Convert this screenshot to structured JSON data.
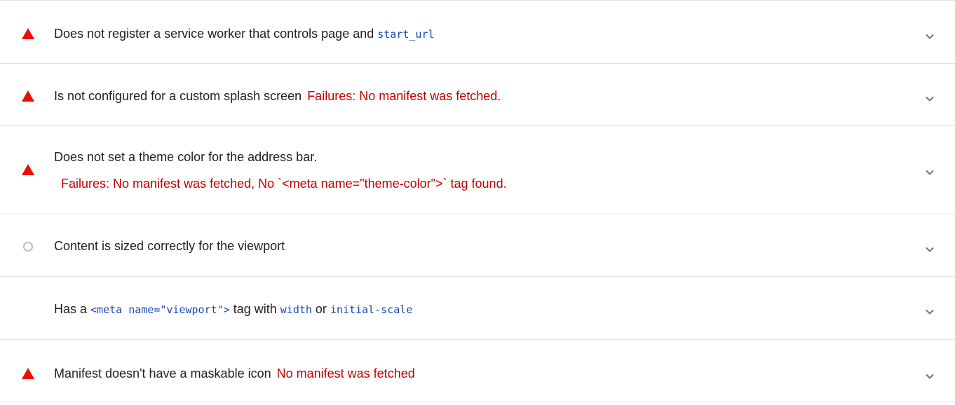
{
  "colors": {
    "fail": "#eb0f00",
    "fail_text": "#c00000",
    "neutral": "#bdbdbd",
    "code": "#1a46b5",
    "divider": "#e0e0e0"
  },
  "audits": [
    {
      "status": "fail",
      "status_icon": "warning-triangle-icon",
      "title_before": "Does not register a service worker that controls page and ",
      "title_code": "start_url"
    },
    {
      "status": "fail",
      "status_icon": "warning-triangle-icon",
      "title": "Is not configured for a custom splash screen",
      "failure": "Failures: No manifest was fetched."
    },
    {
      "status": "fail",
      "status_icon": "warning-triangle-icon",
      "title": "Does not set a theme color for the address bar.",
      "failure": "Failures: No manifest was fetched, No `<meta name=\"theme-color\">` tag found."
    },
    {
      "status": "neutral",
      "status_icon": "circle-icon",
      "title": "Content is sized correctly for the viewport"
    },
    {
      "status": "none",
      "title_prefix": "Has a ",
      "code_meta": "<meta name=\"viewport\">",
      "text_tag_with": " tag with ",
      "code_width": "width",
      "text_or": " or ",
      "code_initial_scale": "initial-scale"
    },
    {
      "status": "fail",
      "status_icon": "warning-triangle-icon",
      "title": "Manifest doesn't have a maskable icon",
      "failure": "No manifest was fetched"
    }
  ],
  "expand_icon": "chevron-down-icon"
}
